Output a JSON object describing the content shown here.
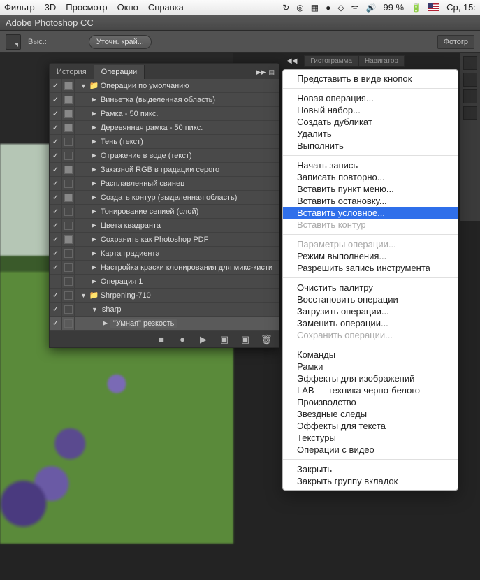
{
  "menubar": {
    "items": [
      "Фильтр",
      "3D",
      "Просмотр",
      "Окно",
      "Справка"
    ],
    "battery": "99 %",
    "clock": "Ср, 15:"
  },
  "app": {
    "title": "Adobe Photoshop CC"
  },
  "optionsbar": {
    "label1": "Выс.:",
    "button1": "Уточн. край...",
    "rightbtn": "Фотогр"
  },
  "dock": {
    "tab1": "Гистограмма",
    "tab2": "Навигатор"
  },
  "panel": {
    "tabs": {
      "history": "История",
      "actions": "Операции"
    },
    "rows": [
      {
        "lvl": 0,
        "chk": true,
        "mode": true,
        "type": "folder",
        "open": true,
        "label": "Операции по умолчанию"
      },
      {
        "lvl": 1,
        "chk": true,
        "mode": true,
        "type": "action",
        "open": false,
        "label": "Виньетка (выделенная область)"
      },
      {
        "lvl": 1,
        "chk": true,
        "mode": true,
        "type": "action",
        "open": false,
        "label": "Рамка - 50 пикс."
      },
      {
        "lvl": 1,
        "chk": true,
        "mode": true,
        "type": "action",
        "open": false,
        "label": "Деревянная рамка - 50 пикс."
      },
      {
        "lvl": 1,
        "chk": true,
        "mode": false,
        "type": "action",
        "open": false,
        "label": "Тень (текст)"
      },
      {
        "lvl": 1,
        "chk": true,
        "mode": false,
        "type": "action",
        "open": false,
        "label": "Отражение в воде (текст)"
      },
      {
        "lvl": 1,
        "chk": true,
        "mode": true,
        "type": "action",
        "open": false,
        "label": "Заказной RGB в градации серого"
      },
      {
        "lvl": 1,
        "chk": true,
        "mode": false,
        "type": "action",
        "open": false,
        "label": "Расплавленный свинец"
      },
      {
        "lvl": 1,
        "chk": true,
        "mode": true,
        "type": "action",
        "open": false,
        "label": "Создать контур (выделенная область)"
      },
      {
        "lvl": 1,
        "chk": true,
        "mode": false,
        "type": "action",
        "open": false,
        "label": "Тонирование сепией (слой)"
      },
      {
        "lvl": 1,
        "chk": true,
        "mode": false,
        "type": "action",
        "open": false,
        "label": "Цвета квадранта"
      },
      {
        "lvl": 1,
        "chk": true,
        "mode": true,
        "type": "action",
        "open": false,
        "label": "Сохранить как Photoshop PDF"
      },
      {
        "lvl": 1,
        "chk": true,
        "mode": false,
        "type": "action",
        "open": false,
        "label": "Карта градиента"
      },
      {
        "lvl": 1,
        "chk": true,
        "mode": false,
        "type": "action",
        "open": false,
        "label": "Настройка краски клонирования для микс-кисти"
      },
      {
        "lvl": 1,
        "chk": false,
        "mode": false,
        "type": "action",
        "open": false,
        "label": "Операция 1"
      },
      {
        "lvl": 0,
        "chk": true,
        "mode": false,
        "type": "folder",
        "open": true,
        "label": "Shrpening-710"
      },
      {
        "lvl": 1,
        "chk": true,
        "mode": false,
        "type": "action",
        "open": true,
        "label": "sharp"
      },
      {
        "lvl": 2,
        "chk": true,
        "mode": false,
        "type": "step",
        "open": false,
        "label": "\"Умная\" резкость",
        "selected": true
      }
    ],
    "footer_icons": [
      "■",
      "●",
      "▶",
      "▣",
      "▣",
      "🗑"
    ]
  },
  "menu": {
    "groups": [
      [
        {
          "label": "Представить в виде кнопок"
        }
      ],
      [
        {
          "label": "Новая операция..."
        },
        {
          "label": "Новый набор..."
        },
        {
          "label": "Создать дубликат"
        },
        {
          "label": "Удалить"
        },
        {
          "label": "Выполнить"
        }
      ],
      [
        {
          "label": "Начать запись"
        },
        {
          "label": "Записать повторно..."
        },
        {
          "label": "Вставить пункт меню..."
        },
        {
          "label": "Вставить остановку..."
        },
        {
          "label": "Вставить условное...",
          "highlight": true
        },
        {
          "label": "Вставить контур",
          "disabled": true
        }
      ],
      [
        {
          "label": "Параметры операции...",
          "disabled": true
        },
        {
          "label": "Режим выполнения..."
        },
        {
          "label": "Разрешить запись инструмента"
        }
      ],
      [
        {
          "label": "Очистить палитру"
        },
        {
          "label": "Восстановить операции"
        },
        {
          "label": "Загрузить операции..."
        },
        {
          "label": "Заменить операции..."
        },
        {
          "label": "Сохранить операции...",
          "disabled": true
        }
      ],
      [
        {
          "label": "Команды"
        },
        {
          "label": "Рамки"
        },
        {
          "label": "Эффекты для изображений"
        },
        {
          "label": "LAB — техника черно-белого"
        },
        {
          "label": "Производство"
        },
        {
          "label": "Звездные следы"
        },
        {
          "label": "Эффекты для текста"
        },
        {
          "label": "Текстуры"
        },
        {
          "label": "Операции с видео"
        }
      ],
      [
        {
          "label": "Закрыть"
        },
        {
          "label": "Закрыть группу вкладок"
        }
      ]
    ]
  }
}
